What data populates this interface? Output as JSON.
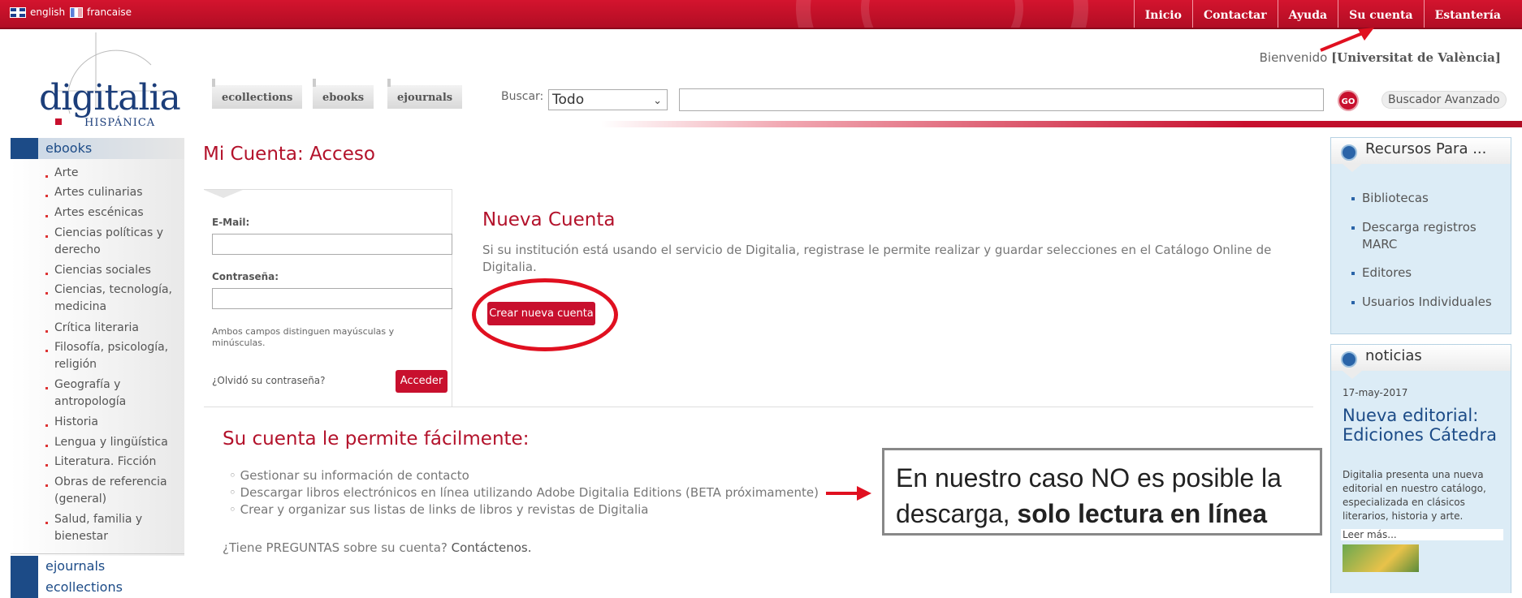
{
  "lang": {
    "english": "english",
    "french": "francaise"
  },
  "topnav": [
    "Inicio",
    "Contactar",
    "Ayuda",
    "Su cuenta",
    "Estantería"
  ],
  "welcome": {
    "prefix": "Bienvenido",
    "institution": "[Universitat de València]"
  },
  "logo": {
    "name": "digitalia",
    "sub": "HISPÁNICA"
  },
  "tabs": [
    "ecollections",
    "ebooks",
    "ejournals"
  ],
  "search": {
    "label": "Buscar:",
    "scope": "Todo",
    "go": "GO",
    "advanced": "Buscador Avanzado"
  },
  "sidebar": {
    "ebooks": "ebooks",
    "items": [
      "Arte",
      "Artes culinarias",
      "Artes escénicas",
      "Ciencias políticas y derecho",
      "Ciencias sociales",
      "Ciencias, tecnología, medicina",
      "Crítica literaria",
      "Filosofía, psicología, religión",
      "Geografía y antropología",
      "Historia",
      "Lengua y lingüística",
      "Literatura. Ficción",
      "Obras de referencia (general)",
      "Salud, familia y bienestar"
    ],
    "ejournals": "ejournals",
    "ecollections": "ecollections"
  },
  "main": {
    "title": "Mi Cuenta: Acceso",
    "login": {
      "email_label": "E-Mail:",
      "password_label": "Contraseña:",
      "hint": "Ambos campos distinguen mayúsculas y minúsculas.",
      "forgot": "¿Olvidó su contraseña?",
      "submit": "Acceder"
    },
    "nueva": {
      "title": "Nueva Cuenta",
      "text": "Si su institución está usando el servicio de Digitalia, registrase le permite realizar y guardar selecciones en el Catálogo Online de Digitalia.",
      "button": "Crear nueva cuenta"
    },
    "permite": {
      "title": "Su cuenta le permite fácilmente:",
      "items": [
        "Gestionar su información de contacto",
        "Descargar libros electrónicos en línea utilizando Adobe Digitalia Editions (BETA próximamente)",
        "Crear y organizar sus listas de links de libros y revistas de Digitalia"
      ]
    },
    "preguntas": {
      "text": "¿Tiene PREGUNTAS sobre su cuenta?",
      "link": "Contáctenos."
    }
  },
  "callout": {
    "text": "En nuestro caso NO es posible la descarga,",
    "bold": "solo lectura en línea"
  },
  "recursos": {
    "title": "Recursos Para ...",
    "links": [
      "Bibliotecas",
      "Descarga registros MARC",
      "Editores",
      "Usuarios Individuales"
    ]
  },
  "noticias": {
    "title": "noticias",
    "date": "17-may-2017",
    "headline": "Nueva editorial: Ediciones Cátedra",
    "text": "Digitalia presenta una nueva editorial en nuestro catálogo, especializada en clásicos literarios, historia y arte.",
    "more": "Leer más..."
  },
  "colors": {
    "brand_red": "#c8102e",
    "brand_blue": "#1c4b87",
    "annotation_red": "#e01020"
  }
}
